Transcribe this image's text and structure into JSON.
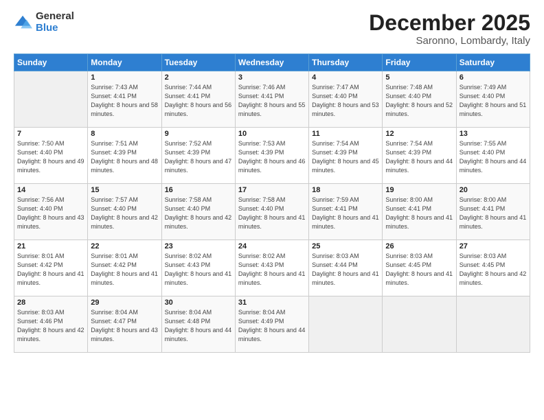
{
  "logo": {
    "general": "General",
    "blue": "Blue"
  },
  "title": "December 2025",
  "location": "Saronno, Lombardy, Italy",
  "days_of_week": [
    "Sunday",
    "Monday",
    "Tuesday",
    "Wednesday",
    "Thursday",
    "Friday",
    "Saturday"
  ],
  "weeks": [
    [
      {
        "day": "",
        "sunrise": "",
        "sunset": "",
        "daylight": ""
      },
      {
        "day": "1",
        "sunrise": "Sunrise: 7:43 AM",
        "sunset": "Sunset: 4:41 PM",
        "daylight": "Daylight: 8 hours and 58 minutes."
      },
      {
        "day": "2",
        "sunrise": "Sunrise: 7:44 AM",
        "sunset": "Sunset: 4:41 PM",
        "daylight": "Daylight: 8 hours and 56 minutes."
      },
      {
        "day": "3",
        "sunrise": "Sunrise: 7:46 AM",
        "sunset": "Sunset: 4:41 PM",
        "daylight": "Daylight: 8 hours and 55 minutes."
      },
      {
        "day": "4",
        "sunrise": "Sunrise: 7:47 AM",
        "sunset": "Sunset: 4:40 PM",
        "daylight": "Daylight: 8 hours and 53 minutes."
      },
      {
        "day": "5",
        "sunrise": "Sunrise: 7:48 AM",
        "sunset": "Sunset: 4:40 PM",
        "daylight": "Daylight: 8 hours and 52 minutes."
      },
      {
        "day": "6",
        "sunrise": "Sunrise: 7:49 AM",
        "sunset": "Sunset: 4:40 PM",
        "daylight": "Daylight: 8 hours and 51 minutes."
      }
    ],
    [
      {
        "day": "7",
        "sunrise": "Sunrise: 7:50 AM",
        "sunset": "Sunset: 4:40 PM",
        "daylight": "Daylight: 8 hours and 49 minutes."
      },
      {
        "day": "8",
        "sunrise": "Sunrise: 7:51 AM",
        "sunset": "Sunset: 4:39 PM",
        "daylight": "Daylight: 8 hours and 48 minutes."
      },
      {
        "day": "9",
        "sunrise": "Sunrise: 7:52 AM",
        "sunset": "Sunset: 4:39 PM",
        "daylight": "Daylight: 8 hours and 47 minutes."
      },
      {
        "day": "10",
        "sunrise": "Sunrise: 7:53 AM",
        "sunset": "Sunset: 4:39 PM",
        "daylight": "Daylight: 8 hours and 46 minutes."
      },
      {
        "day": "11",
        "sunrise": "Sunrise: 7:54 AM",
        "sunset": "Sunset: 4:39 PM",
        "daylight": "Daylight: 8 hours and 45 minutes."
      },
      {
        "day": "12",
        "sunrise": "Sunrise: 7:54 AM",
        "sunset": "Sunset: 4:39 PM",
        "daylight": "Daylight: 8 hours and 44 minutes."
      },
      {
        "day": "13",
        "sunrise": "Sunrise: 7:55 AM",
        "sunset": "Sunset: 4:40 PM",
        "daylight": "Daylight: 8 hours and 44 minutes."
      }
    ],
    [
      {
        "day": "14",
        "sunrise": "Sunrise: 7:56 AM",
        "sunset": "Sunset: 4:40 PM",
        "daylight": "Daylight: 8 hours and 43 minutes."
      },
      {
        "day": "15",
        "sunrise": "Sunrise: 7:57 AM",
        "sunset": "Sunset: 4:40 PM",
        "daylight": "Daylight: 8 hours and 42 minutes."
      },
      {
        "day": "16",
        "sunrise": "Sunrise: 7:58 AM",
        "sunset": "Sunset: 4:40 PM",
        "daylight": "Daylight: 8 hours and 42 minutes."
      },
      {
        "day": "17",
        "sunrise": "Sunrise: 7:58 AM",
        "sunset": "Sunset: 4:40 PM",
        "daylight": "Daylight: 8 hours and 41 minutes."
      },
      {
        "day": "18",
        "sunrise": "Sunrise: 7:59 AM",
        "sunset": "Sunset: 4:41 PM",
        "daylight": "Daylight: 8 hours and 41 minutes."
      },
      {
        "day": "19",
        "sunrise": "Sunrise: 8:00 AM",
        "sunset": "Sunset: 4:41 PM",
        "daylight": "Daylight: 8 hours and 41 minutes."
      },
      {
        "day": "20",
        "sunrise": "Sunrise: 8:00 AM",
        "sunset": "Sunset: 4:41 PM",
        "daylight": "Daylight: 8 hours and 41 minutes."
      }
    ],
    [
      {
        "day": "21",
        "sunrise": "Sunrise: 8:01 AM",
        "sunset": "Sunset: 4:42 PM",
        "daylight": "Daylight: 8 hours and 41 minutes."
      },
      {
        "day": "22",
        "sunrise": "Sunrise: 8:01 AM",
        "sunset": "Sunset: 4:42 PM",
        "daylight": "Daylight: 8 hours and 41 minutes."
      },
      {
        "day": "23",
        "sunrise": "Sunrise: 8:02 AM",
        "sunset": "Sunset: 4:43 PM",
        "daylight": "Daylight: 8 hours and 41 minutes."
      },
      {
        "day": "24",
        "sunrise": "Sunrise: 8:02 AM",
        "sunset": "Sunset: 4:43 PM",
        "daylight": "Daylight: 8 hours and 41 minutes."
      },
      {
        "day": "25",
        "sunrise": "Sunrise: 8:03 AM",
        "sunset": "Sunset: 4:44 PM",
        "daylight": "Daylight: 8 hours and 41 minutes."
      },
      {
        "day": "26",
        "sunrise": "Sunrise: 8:03 AM",
        "sunset": "Sunset: 4:45 PM",
        "daylight": "Daylight: 8 hours and 41 minutes."
      },
      {
        "day": "27",
        "sunrise": "Sunrise: 8:03 AM",
        "sunset": "Sunset: 4:45 PM",
        "daylight": "Daylight: 8 hours and 42 minutes."
      }
    ],
    [
      {
        "day": "28",
        "sunrise": "Sunrise: 8:03 AM",
        "sunset": "Sunset: 4:46 PM",
        "daylight": "Daylight: 8 hours and 42 minutes."
      },
      {
        "day": "29",
        "sunrise": "Sunrise: 8:04 AM",
        "sunset": "Sunset: 4:47 PM",
        "daylight": "Daylight: 8 hours and 43 minutes."
      },
      {
        "day": "30",
        "sunrise": "Sunrise: 8:04 AM",
        "sunset": "Sunset: 4:48 PM",
        "daylight": "Daylight: 8 hours and 44 minutes."
      },
      {
        "day": "31",
        "sunrise": "Sunrise: 8:04 AM",
        "sunset": "Sunset: 4:49 PM",
        "daylight": "Daylight: 8 hours and 44 minutes."
      },
      {
        "day": "",
        "sunrise": "",
        "sunset": "",
        "daylight": ""
      },
      {
        "day": "",
        "sunrise": "",
        "sunset": "",
        "daylight": ""
      },
      {
        "day": "",
        "sunrise": "",
        "sunset": "",
        "daylight": ""
      }
    ]
  ]
}
